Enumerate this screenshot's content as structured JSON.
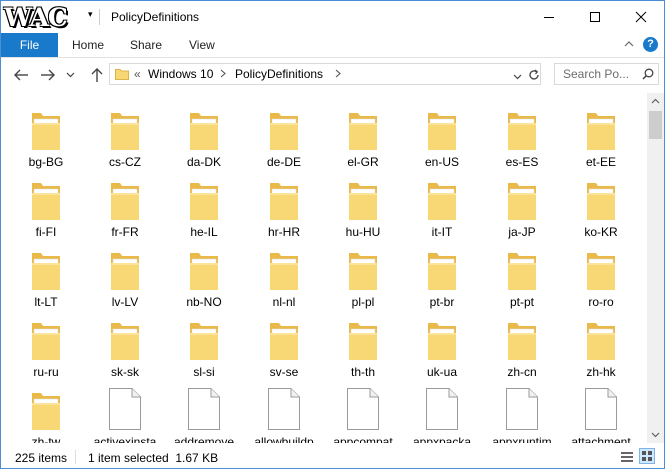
{
  "window": {
    "title": "PolicyDefinitions",
    "logo": "WAC"
  },
  "ribbon": {
    "tabs": [
      "File",
      "Home",
      "Share",
      "View"
    ]
  },
  "address": {
    "overflow": "«",
    "crumbs": [
      "Windows 10",
      "PolicyDefinitions"
    ]
  },
  "search": {
    "placeholder": "Search Po..."
  },
  "items": [
    {
      "label": "bg-BG",
      "type": "folder"
    },
    {
      "label": "cs-CZ",
      "type": "folder"
    },
    {
      "label": "da-DK",
      "type": "folder"
    },
    {
      "label": "de-DE",
      "type": "folder"
    },
    {
      "label": "el-GR",
      "type": "folder"
    },
    {
      "label": "en-US",
      "type": "folder"
    },
    {
      "label": "es-ES",
      "type": "folder"
    },
    {
      "label": "et-EE",
      "type": "folder"
    },
    {
      "label": "fi-FI",
      "type": "folder"
    },
    {
      "label": "fr-FR",
      "type": "folder"
    },
    {
      "label": "he-IL",
      "type": "folder"
    },
    {
      "label": "hr-HR",
      "type": "folder"
    },
    {
      "label": "hu-HU",
      "type": "folder"
    },
    {
      "label": "it-IT",
      "type": "folder"
    },
    {
      "label": "ja-JP",
      "type": "folder"
    },
    {
      "label": "ko-KR",
      "type": "folder"
    },
    {
      "label": "lt-LT",
      "type": "folder"
    },
    {
      "label": "lv-LV",
      "type": "folder"
    },
    {
      "label": "nb-NO",
      "type": "folder"
    },
    {
      "label": "nl-nl",
      "type": "folder"
    },
    {
      "label": "pl-pl",
      "type": "folder"
    },
    {
      "label": "pt-br",
      "type": "folder"
    },
    {
      "label": "pt-pt",
      "type": "folder"
    },
    {
      "label": "ro-ro",
      "type": "folder"
    },
    {
      "label": "ru-ru",
      "type": "folder"
    },
    {
      "label": "sk-sk",
      "type": "folder"
    },
    {
      "label": "sl-si",
      "type": "folder"
    },
    {
      "label": "sv-se",
      "type": "folder"
    },
    {
      "label": "th-th",
      "type": "folder"
    },
    {
      "label": "uk-ua",
      "type": "folder"
    },
    {
      "label": "zh-cn",
      "type": "folder"
    },
    {
      "label": "zh-hk",
      "type": "folder"
    },
    {
      "label": "zh-tw",
      "type": "folder"
    },
    {
      "label": "activexinsta",
      "type": "file"
    },
    {
      "label": "addremove",
      "type": "file"
    },
    {
      "label": "allowbuildp",
      "type": "file"
    },
    {
      "label": "appcompat",
      "type": "file"
    },
    {
      "label": "appxpacka",
      "type": "file"
    },
    {
      "label": "appxruntim",
      "type": "file"
    },
    {
      "label": "attachment",
      "type": "file"
    }
  ],
  "status": {
    "item_count": "225 items",
    "selection": "1 item selected  1.67 KB"
  }
}
